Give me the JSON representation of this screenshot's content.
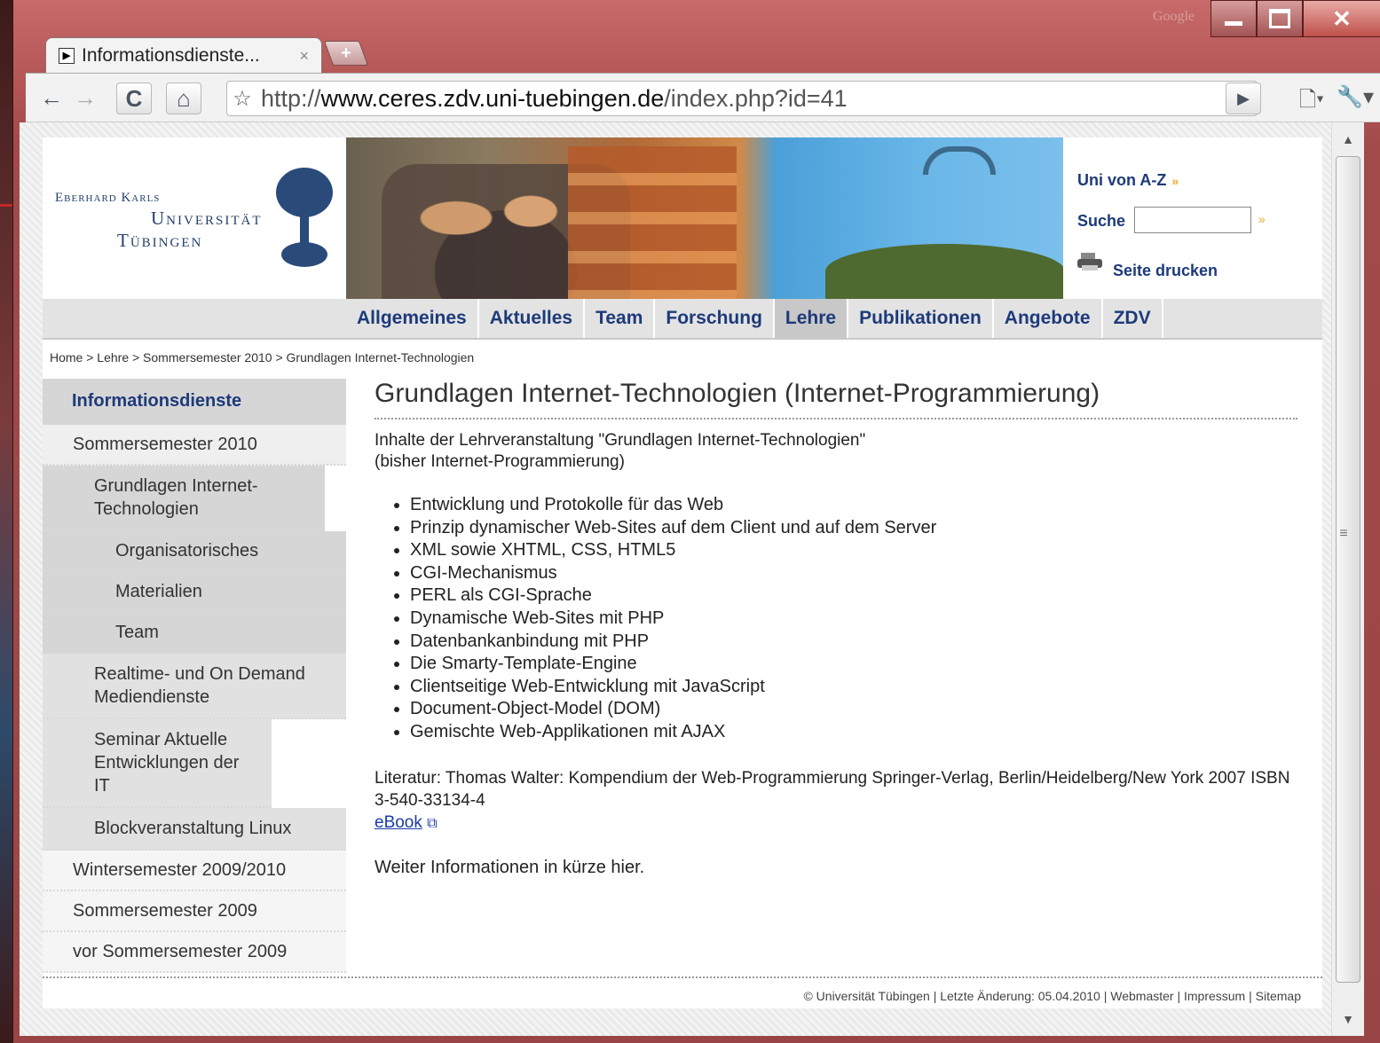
{
  "window": {
    "brand_mark": "Google",
    "tab_title": "Informationsdienste...",
    "new_tab_symbol": "+"
  },
  "toolbar": {
    "url_prefix": "http://",
    "url_domain": "www.ceres.zdv.uni-tuebingen.de",
    "url_path": "/index.php?id=41"
  },
  "header": {
    "logo_line1": "Eberhard Karls",
    "logo_line2": "Universität",
    "logo_line3": "Tübingen",
    "uni_az": "Uni von A-Z",
    "search_label": "Suche",
    "search_value": "",
    "print_label": "Seite drucken"
  },
  "nav": {
    "items": [
      "Allgemeines",
      "Aktuelles",
      "Team",
      "Forschung",
      "Lehre",
      "Publikationen",
      "Angebote",
      "ZDV"
    ],
    "active": "Lehre"
  },
  "breadcrumb": "Home > Lehre > Sommersemester 2010 > Grundlagen Internet-Technologien",
  "sidebar": {
    "items": [
      "Informationsdienste",
      "Sommersemester 2010",
      "Grundlagen Internet-Technologien",
      "Organisatorisches",
      "Materialien",
      "Team",
      "Realtime- und On Demand Mediendienste",
      "Seminar Aktuelle Entwicklungen der IT",
      "Blockveranstaltung Linux",
      "Wintersemester 2009/2010",
      "Sommersemester 2009",
      "vor Sommersemester 2009"
    ]
  },
  "content": {
    "title": "Grundlagen Internet-Technologien (Internet-Programmierung)",
    "intro_line1": "Inhalte der Lehrveranstaltung \"Grundlagen Internet-Technologien\"",
    "intro_line2": "(bisher Internet-Programmierung)",
    "topics": [
      "Entwicklung und Protokolle für das Web",
      "Prinzip dynamischer Web-Sites auf dem Client und auf dem Server",
      "XML sowie XHTML, CSS, HTML5",
      "CGI-Mechanismus",
      "PERL als CGI-Sprache",
      "Dynamische Web-Sites mit PHP",
      "Datenbankanbindung mit PHP",
      "Die Smarty-Template-Engine",
      "Clientseitige Web-Entwicklung mit JavaScript",
      "Document-Object-Model (DOM)",
      "Gemischte Web-Applikationen mit AJAX"
    ],
    "literature": "Literatur: Thomas Walter: Kompendium der Web-Programmierung Springer-Verlag, Berlin/Heidelberg/New York 2007 ISBN 3-540-33134-4",
    "ebook_label": "eBook",
    "more": "Weiter Informationen in kürze hier."
  },
  "footer": {
    "text": "© Universität Tübingen | Letzte Änderung: 05.04.2010 | Webmaster | Impressum | Sitemap"
  },
  "colors": {
    "link_blue": "#1d3a7a",
    "accent_orange": "#f5a623"
  }
}
